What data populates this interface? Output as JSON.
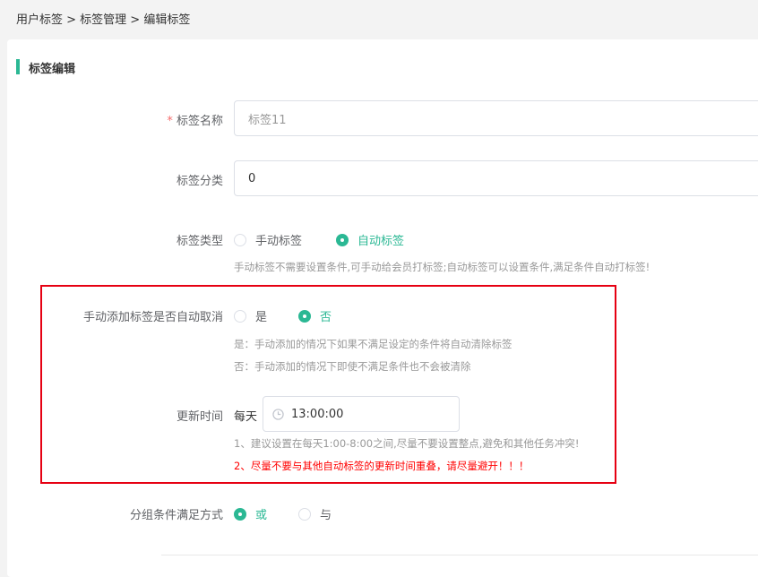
{
  "breadcrumb": "用户标签 > 标签管理 > 编辑标签",
  "section_title": "标签编辑",
  "form": {
    "name": {
      "required_mark": "*",
      "label": "标签名称",
      "value": "标签11"
    },
    "category": {
      "label": "标签分类",
      "value": "0"
    },
    "type": {
      "label": "标签类型",
      "options": [
        "手动标签",
        "自动标签"
      ],
      "selected": "自动标签",
      "hint": "手动标签不需要设置条件,可手动给会员打标签;自动标签可以设置条件,满足条件自动打标签!"
    },
    "auto_cancel": {
      "label": "手动添加标签是否自动取消",
      "options": [
        "是",
        "否"
      ],
      "selected": "否",
      "hint_yes": "是：手动添加的情况下如果不满足设定的条件将自动清除标签",
      "hint_no": "否：手动添加的情况下即使不满足条件也不会被清除"
    },
    "update_time": {
      "label": "更新时间",
      "prefix": "每天",
      "value": "13:00:00",
      "hint1": "1、建议设置在每天1:00-8:00之间,尽量不要设置整点,避免和其他任务冲突!",
      "hint2": "2、尽量不要与其他自动标签的更新时间重叠，请尽量避开！！！"
    },
    "group_condition": {
      "label": "分组条件满足方式",
      "options": [
        "或",
        "与"
      ],
      "selected": "或"
    }
  },
  "colors": {
    "accent": "#2bb894",
    "warning": "#ff0000",
    "highlight_border": "#e60012"
  }
}
